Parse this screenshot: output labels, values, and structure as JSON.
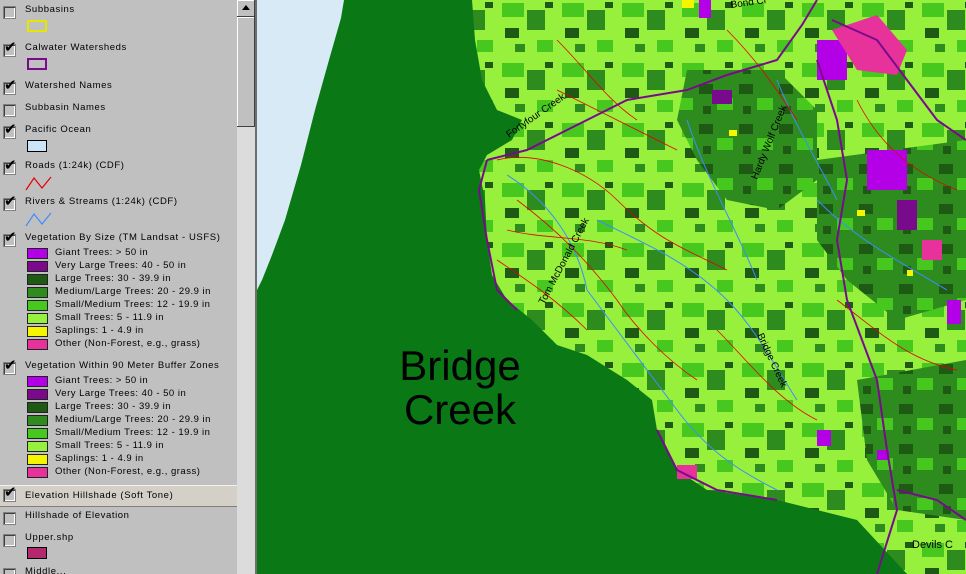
{
  "legend": {
    "layers": [
      {
        "label": "Subbasins",
        "checked": false
      },
      {
        "label": "Calwater Watersheds",
        "checked": true
      },
      {
        "label": "Watershed Names",
        "checked": true
      },
      {
        "label": "Subbasin Names",
        "checked": false
      },
      {
        "label": "Pacific Ocean",
        "checked": true
      },
      {
        "label": "Roads (1:24k) (CDF)",
        "checked": true
      },
      {
        "label": "Rivers & Streams (1:24k) (CDF)",
        "checked": true
      },
      {
        "label": "Vegetation By Size (TM Landsat - USFS)",
        "checked": true
      },
      {
        "label": "Vegetation Within 90 Meter Buffer Zones",
        "checked": true
      },
      {
        "label": "Elevation Hillshade (Soft Tone)",
        "checked": true
      },
      {
        "label": "Hillshade of Elevation",
        "checked": false
      },
      {
        "label": "Upper.shp",
        "checked": false
      },
      {
        "label": "Middle...",
        "checked": false
      }
    ],
    "veg_classes": [
      {
        "label": "Giant Trees: > 50 in",
        "color": "#b400e6"
      },
      {
        "label": "Very Large Trees: 40 - 50 in",
        "color": "#7a0a8c"
      },
      {
        "label": "Large Trees: 30 - 39.9 in",
        "color": "#1e5a14"
      },
      {
        "label": "Medium/Large Trees: 20 - 29.9 in",
        "color": "#2e8c1e"
      },
      {
        "label": "Small/Medium Trees: 12 - 19.9 in",
        "color": "#46c81e"
      },
      {
        "label": "Small Trees: 5 - 11.9 in",
        "color": "#96f03c"
      },
      {
        "label": "Saplings: 1 - 4.9 in",
        "color": "#f5f500"
      },
      {
        "label": "Other (Non-Forest, e.g., grass)",
        "color": "#e6329a"
      }
    ],
    "buffer_classes": [
      {
        "label": "Giant Trees: > 50 in",
        "color": "#b400e6"
      },
      {
        "label": "Very Large Trees: 40 - 50 in",
        "color": "#7a0a8c"
      },
      {
        "label": "Large Trees: 30 - 39.9 in",
        "color": "#1e5a14"
      },
      {
        "label": "Medium/Large Trees: 20 - 29.9 in",
        "color": "#2e8c1e"
      },
      {
        "label": "Small/Medium Trees: 12 - 19.9 in",
        "color": "#46c81e"
      },
      {
        "label": "Small Trees: 5 - 11.9 in",
        "color": "#96f03c"
      },
      {
        "label": "Saplings: 1 - 4.9 in",
        "color": "#f5f500"
      },
      {
        "label": "Other (Non-Forest, e.g., grass)",
        "color": "#e6329a"
      }
    ],
    "symbols": {
      "subbasin_outline": "#e6e600",
      "watershed_outline": "#7a0a8c",
      "ocean_fill": "#cce4f7",
      "road_color": "#e60000",
      "stream_color": "#3c8cff",
      "upper_fill": "#b4286e"
    }
  },
  "map": {
    "ocean_color": "#d9eaf7",
    "base_green": "#0a7814",
    "watershed_label": "Bridge Creek",
    "watershed_label_line1": "Bridge",
    "watershed_label_line2": "Creek",
    "creek_labels": {
      "bond": "Bond Cr",
      "fortyfour": "Fortyfour Creek",
      "hardy": "Hardy Wolf Creek",
      "tom": "Tom McDonald Creek",
      "bridge": "Bridge Creek",
      "devils": "Devils C"
    }
  }
}
